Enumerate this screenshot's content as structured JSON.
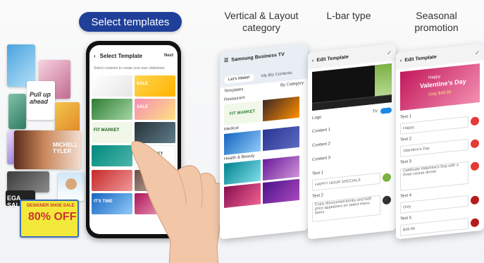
{
  "header": {
    "select_pill": "Select templates",
    "col_vertical": "Vertical & Layout\ncategory",
    "col_lbar": "L-bar type",
    "col_seasonal": "Seasonal\npromotion"
  },
  "collage": {
    "pullup": "Pull up\nahead",
    "michelle_tyler": "MICHELL\nTYLER",
    "designer_sale": "DESIGNER SHOE SALE",
    "off": "80% OFF",
    "ega_sale": "EGA SALE"
  },
  "phone": {
    "title": "Select Template",
    "next": "Next",
    "subtitle": "Select contents to create your own slideshow.",
    "cells": [
      "",
      "SALE",
      "",
      "SALE",
      "FIT MARKET",
      "",
      "",
      "FIT MARKET",
      "",
      "",
      "IT'S TIME",
      ""
    ]
  },
  "vertical_screen": {
    "app_title": "Samsung Business TV",
    "tab_lets_make": "Let's Make!",
    "tab_my_biz": "My Biz Contents",
    "templates_label": "Templates",
    "sort_label": "By Category",
    "cat_restaurant": "Restaurant",
    "cat_medical": "Medical",
    "cat_health": "Health & Beauty",
    "fit_market": "FIT MARKET"
  },
  "lbar_screen": {
    "title": "Edit Template",
    "logo_label": "Logo",
    "tv_label": "TV",
    "content1": "Content 1",
    "content2": "Content 2",
    "content3": "Content 3",
    "text1": "Text 1",
    "text1_value": "HAPPY HOUR SPECIALS",
    "text2": "Text 2",
    "text2_value": "Enjoy discounted drinks and half-price appetizers on select menu items"
  },
  "seasonal_screen": {
    "title": "Edit Template",
    "banner_line1": "Happy",
    "banner_line2": "Valentine's Day",
    "banner_price": "Only $49.99",
    "text1": "Text 1",
    "text1_value": "Happy",
    "text2": "Text 2",
    "text2_value": "Valentine's Day",
    "text3": "Text 3",
    "text3_value": "Celebrate Valentine's Day with a three course dinner",
    "text4": "Text 4",
    "text4_value": "Only",
    "text5": "Text 5",
    "text5_value": "$49.99"
  }
}
